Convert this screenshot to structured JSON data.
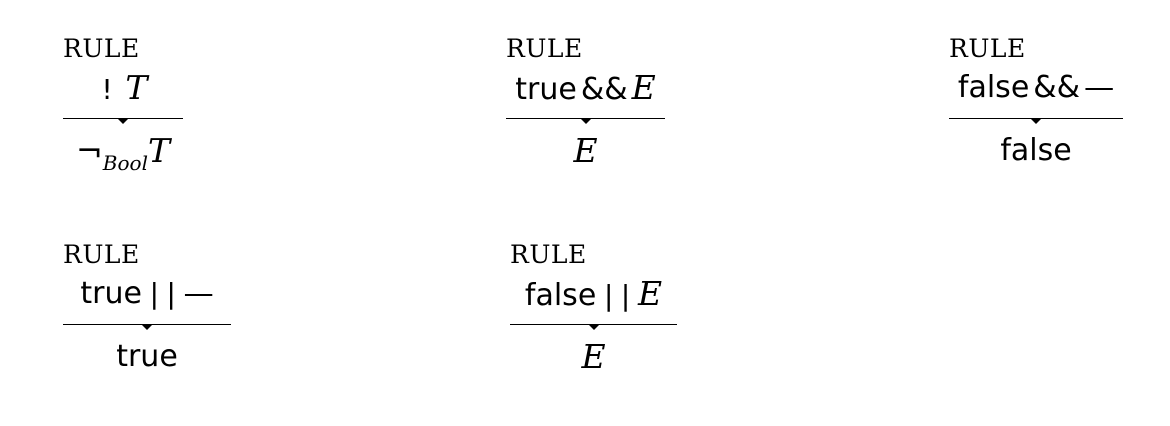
{
  "rules": [
    {
      "label": "RULE",
      "premise_op": "!",
      "premise_var": "T",
      "conclusion_op": "¬",
      "conclusion_sub": "Bool",
      "conclusion_var": "T"
    },
    {
      "label": "RULE",
      "premise_lit": "true",
      "premise_op": "&&",
      "premise_var": "E",
      "conclusion_var": "E"
    },
    {
      "label": "RULE",
      "premise_lit": "false",
      "premise_op": "&&",
      "premise_var": "—",
      "conclusion_lit": "false"
    },
    {
      "label": "RULE",
      "premise_lit": "true",
      "premise_op": "||",
      "premise_var": "—",
      "conclusion_lit": "true"
    },
    {
      "label": "RULE",
      "premise_lit": "false",
      "premise_op": "||",
      "premise_var": "E",
      "conclusion_var": "E"
    }
  ]
}
